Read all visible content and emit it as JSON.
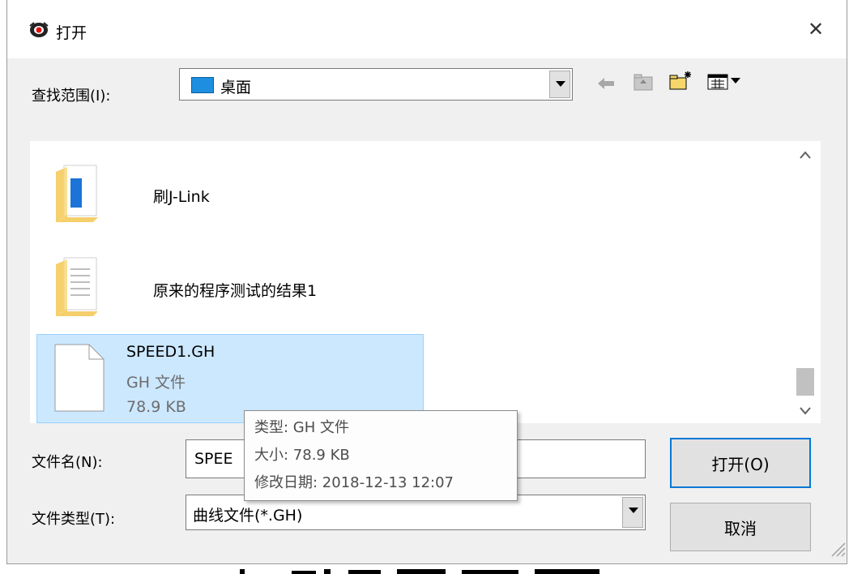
{
  "window": {
    "title": "打开",
    "close_glyph": "✕"
  },
  "lookin": {
    "label": "查找范围(I):",
    "value": "桌面"
  },
  "toolbar": {
    "back_icon": "back-arrow-icon",
    "up_icon": "up-folder-icon",
    "new_folder_icon": "new-folder-icon",
    "view_menu_icon": "view-menu-icon"
  },
  "files": [
    {
      "name": "刷J-Link",
      "kind": "folder"
    },
    {
      "name": "原来的程序测试的结果1",
      "kind": "folder"
    },
    {
      "name": "SPEED1.GH",
      "type": "GH 文件",
      "size": "78.9 KB",
      "kind": "file",
      "selected": true
    }
  ],
  "tooltip": {
    "type_line": "类型: GH 文件",
    "size_line": "大小: 78.9 KB",
    "date_line": "修改日期: 2018-12-13 12:07"
  },
  "filename": {
    "label": "文件名(N):",
    "value": "SPEE"
  },
  "filetype": {
    "label": "文件类型(T):",
    "value": "曲线文件(*.GH)"
  },
  "buttons": {
    "open": "打开(O)",
    "cancel": "取消"
  },
  "colors": {
    "selection": "#cce8ff",
    "selection_border": "#99d1ff",
    "folder": "#f8d775"
  }
}
